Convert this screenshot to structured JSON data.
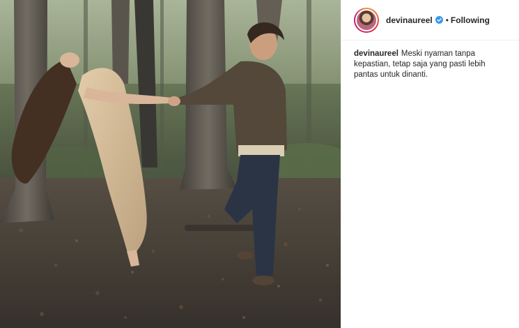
{
  "post": {
    "author": {
      "username": "devinaureel",
      "verified": true,
      "follow_status": "Following",
      "separator": "•"
    },
    "caption": {
      "username": "devinaureel",
      "text": "Meski nyaman tanpa kepastian, tetap saja yang pasti lebih pantas untuk dinanti."
    }
  },
  "icons": {
    "verified": "verified-badge-icon"
  },
  "colors": {
    "text": "#262626",
    "verified_badge": "#3897f0",
    "divider": "#efefef"
  }
}
